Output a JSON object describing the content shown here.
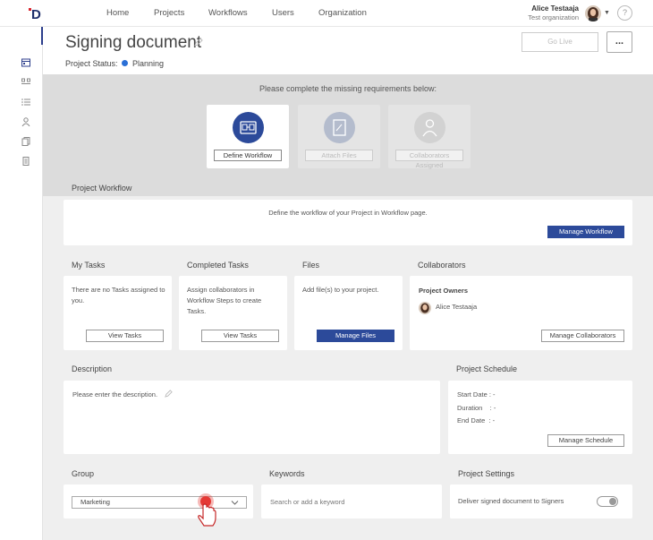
{
  "nav": {
    "items": [
      {
        "label": "Home"
      },
      {
        "label": "Projects"
      },
      {
        "label": "Workflows"
      },
      {
        "label": "Users"
      },
      {
        "label": "Organization"
      }
    ]
  },
  "user": {
    "name": "Alice Testaaja",
    "org": "Test organization"
  },
  "project": {
    "title": "Signing document",
    "status_label": "Project Status:",
    "status_value": "Planning",
    "status_color": "#2a6fd6",
    "go_live_label": "Go Live",
    "more_label": "..."
  },
  "requirements": {
    "message": "Please complete the missing requirements below:",
    "items": [
      {
        "label": "Define Workflow",
        "icon": "workflow-icon",
        "active": true
      },
      {
        "label": "Attach Files",
        "icon": "file-icon",
        "active": false
      },
      {
        "label": "Collaborators Assigned",
        "icon": "user-icon",
        "active": false
      }
    ]
  },
  "workflow": {
    "heading": "Project Workflow",
    "text": "Define the workflow of your Project in Workflow page.",
    "button": "Manage Workflow"
  },
  "tasks": {
    "heading": "My Tasks",
    "text": "There are no Tasks assigned to you.",
    "button": "View Tasks"
  },
  "completed": {
    "heading": "Completed Tasks",
    "text": "Assign collaborators in Workflow Steps to create Tasks.",
    "button": "View Tasks"
  },
  "files": {
    "heading": "Files",
    "text": "Add file(s) to your project.",
    "button": "Manage Files"
  },
  "collaborators": {
    "heading": "Collaborators",
    "owners_label": "Project Owners",
    "owner_name": "Alice Testaaja",
    "button": "Manage Collaborators"
  },
  "description": {
    "heading": "Description",
    "text": "Please enter the description."
  },
  "schedule": {
    "heading": "Project Schedule",
    "start": "Start Date : -",
    "duration": "Duration    : -",
    "end": "End Date  : -",
    "button": "Manage Schedule"
  },
  "group": {
    "heading": "Group",
    "value": "Marketing"
  },
  "keywords": {
    "heading": "Keywords",
    "placeholder": "Search or add a keyword"
  },
  "settings": {
    "heading": "Project Settings",
    "toggle_label": "Deliver signed document to Signers",
    "toggle_on": false
  },
  "colors": {
    "accent": "#2c4a9a",
    "brand_red": "#d9262f"
  }
}
